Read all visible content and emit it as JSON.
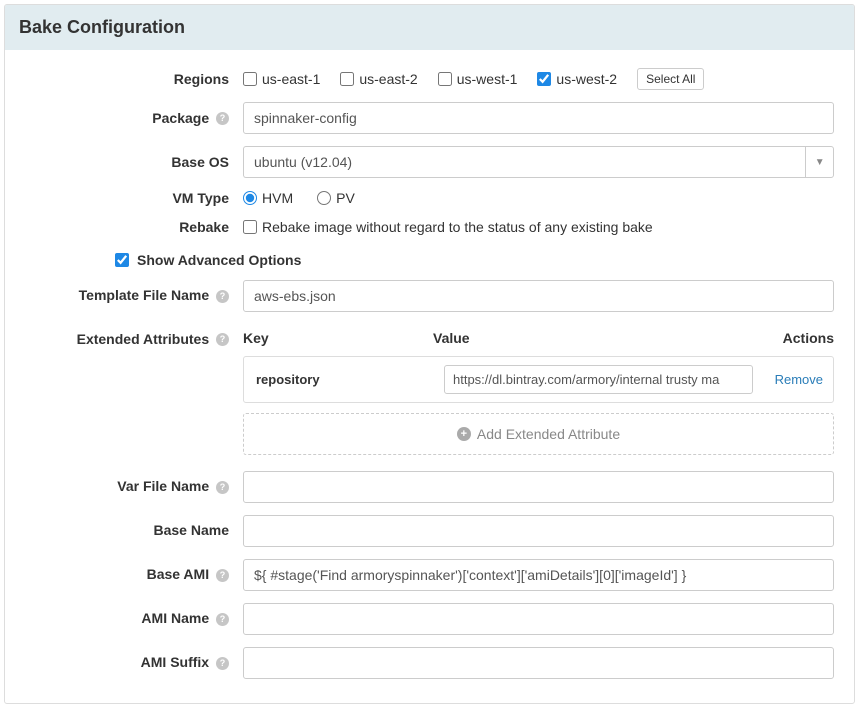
{
  "header": {
    "title": "Bake Configuration"
  },
  "labels": {
    "regions": "Regions",
    "package": "Package",
    "baseos": "Base OS",
    "vmtype": "VM Type",
    "rebake": "Rebake",
    "advanced": "Show Advanced Options",
    "templateFile": "Template File Name",
    "extAttr": "Extended Attributes",
    "varFile": "Var File Name",
    "baseName": "Base Name",
    "baseAmi": "Base AMI",
    "amiName": "AMI Name",
    "amiSuffix": "AMI Suffix"
  },
  "regions": {
    "options": [
      {
        "label": "us-east-1",
        "checked": false
      },
      {
        "label": "us-east-2",
        "checked": false
      },
      {
        "label": "us-west-1",
        "checked": false
      },
      {
        "label": "us-west-2",
        "checked": true
      }
    ],
    "selectAll": "Select All"
  },
  "package": {
    "value": "spinnaker-config"
  },
  "baseos": {
    "value": "ubuntu (v12.04)"
  },
  "vmtype": {
    "options": [
      {
        "label": "HVM",
        "checked": true
      },
      {
        "label": "PV",
        "checked": false
      }
    ]
  },
  "rebake": {
    "text": "Rebake image without regard to the status of any existing bake",
    "checked": false
  },
  "advanced": {
    "checked": true
  },
  "templateFile": {
    "value": "aws-ebs.json"
  },
  "extAttr": {
    "headers": {
      "key": "Key",
      "value": "Value",
      "actions": "Actions"
    },
    "rows": [
      {
        "key": "repository",
        "value": "https://dl.bintray.com/armory/internal trusty ma"
      }
    ],
    "removeLabel": "Remove",
    "addLabel": "Add Extended Attribute"
  },
  "varFile": {
    "value": ""
  },
  "baseName": {
    "value": ""
  },
  "baseAmi": {
    "value": "${ #stage('Find armoryspinnaker')['context']['amiDetails'][0]['imageId'] }"
  },
  "amiName": {
    "value": ""
  },
  "amiSuffix": {
    "value": ""
  }
}
